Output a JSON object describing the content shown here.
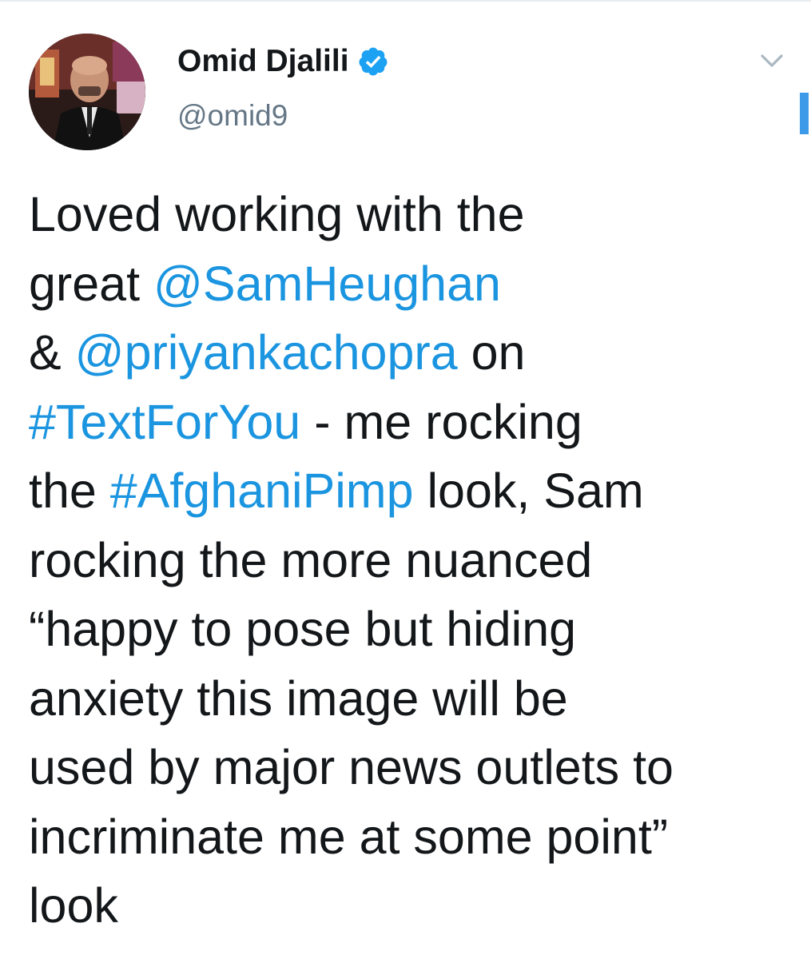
{
  "header": {
    "display_name": "Omid Djalili",
    "handle": "@omid9",
    "verified": true,
    "verified_icon": "verified-badge-icon",
    "menu_icon": "chevron-down-icon"
  },
  "tweet": {
    "lines": [
      [
        {
          "text": "Loved working with the",
          "type": "text"
        }
      ],
      [
        {
          "text": "great ",
          "type": "text"
        },
        {
          "text": "@SamHeughan",
          "type": "mention"
        }
      ],
      [
        {
          "text": "& ",
          "type": "text"
        },
        {
          "text": "@priyankachopra",
          "type": "mention"
        },
        {
          "text": " on",
          "type": "text"
        }
      ],
      [
        {
          "text": "#TextForYou",
          "type": "hashtag"
        },
        {
          "text": " - me rocking",
          "type": "text"
        }
      ],
      [
        {
          "text": "the ",
          "type": "text"
        },
        {
          "text": "#AfghaniPimp",
          "type": "hashtag"
        },
        {
          "text": " look, Sam",
          "type": "text"
        }
      ],
      [
        {
          "text": "rocking the more nuanced",
          "type": "text"
        }
      ],
      [
        {
          "text": "“happy to pose but hiding",
          "type": "text"
        }
      ],
      [
        {
          "text": "anxiety this image will be",
          "type": "text"
        }
      ],
      [
        {
          "text": "used by major news outlets to",
          "type": "text"
        }
      ],
      [
        {
          "text": "incriminate me at some point”",
          "type": "text"
        }
      ],
      [
        {
          "text": "look",
          "type": "text"
        }
      ]
    ]
  },
  "colors": {
    "link": "#1b95e0",
    "text": "#14171a",
    "secondary": "#657786",
    "verified": "#1da1f2"
  }
}
